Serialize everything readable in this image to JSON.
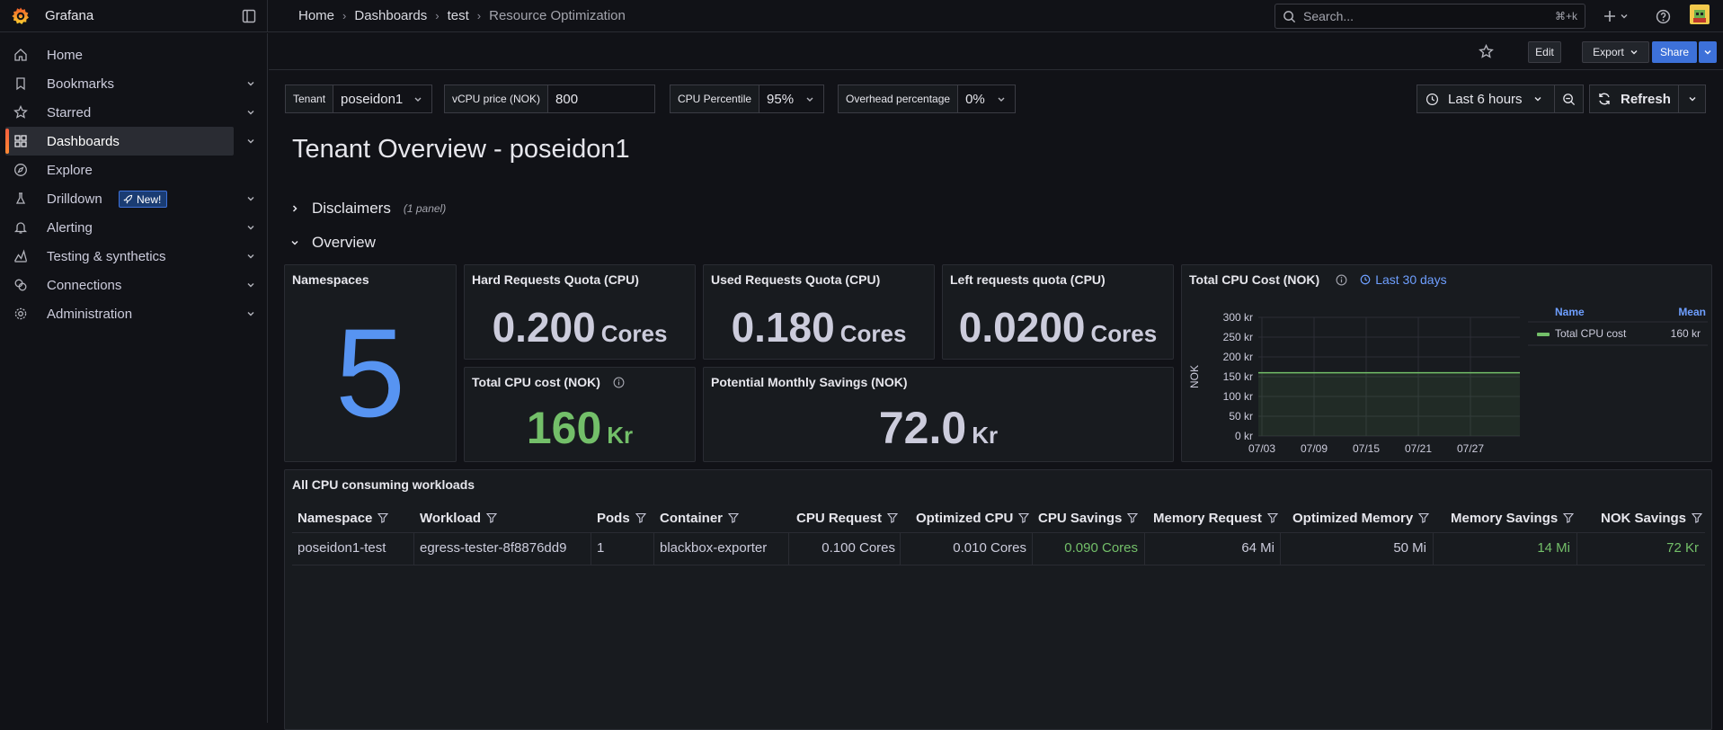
{
  "app": {
    "name": "Grafana"
  },
  "breadcrumbs": [
    "Home",
    "Dashboards",
    "test",
    "Resource Optimization"
  ],
  "search": {
    "placeholder": "Search...",
    "shortcut": "⌘+k"
  },
  "toolbar": {
    "edit": "Edit",
    "export": "Export",
    "share": "Share"
  },
  "sidebar": {
    "items": [
      {
        "label": "Home",
        "icon": "home-icon"
      },
      {
        "label": "Bookmarks",
        "icon": "bookmark-icon"
      },
      {
        "label": "Starred",
        "icon": "star-icon"
      },
      {
        "label": "Dashboards",
        "icon": "apps-icon",
        "active": true
      },
      {
        "label": "Explore",
        "icon": "compass-icon"
      },
      {
        "label": "Drilldown",
        "icon": "drilldown-icon",
        "badge": "New!"
      },
      {
        "label": "Alerting",
        "icon": "bell-icon"
      },
      {
        "label": "Testing & synthetics",
        "icon": "heart-rate-icon"
      },
      {
        "label": "Connections",
        "icon": "link-icon"
      },
      {
        "label": "Administration",
        "icon": "cog-icon"
      }
    ]
  },
  "variables": {
    "tenant": {
      "label": "Tenant",
      "value": "poseidon1"
    },
    "vcpu": {
      "label": "vCPU price (NOK)",
      "value": "800"
    },
    "percentile": {
      "label": "CPU Percentile",
      "value": "95%"
    },
    "overhead": {
      "label": "Overhead percentage",
      "value": "0%"
    }
  },
  "timepicker": {
    "range": "Last 6 hours",
    "refresh": "Refresh"
  },
  "dashboard": {
    "title": "Tenant Overview - poseidon1"
  },
  "rows": {
    "disclaimers": {
      "title": "Disclaimers",
      "note": "(1 panel)"
    },
    "overview": {
      "title": "Overview"
    }
  },
  "panels": {
    "namespaces": {
      "title": "Namespaces",
      "value": "5"
    },
    "hard_quota": {
      "title": "Hard Requests Quota (CPU)",
      "value": "0.200",
      "unit": "Cores"
    },
    "used_quota": {
      "title": "Used Requests Quota (CPU)",
      "value": "0.180",
      "unit": "Cores"
    },
    "left_quota": {
      "title": "Left requests quota (CPU)",
      "value": "0.0200",
      "unit": "Cores"
    },
    "total_cost": {
      "title": "Total CPU cost (NOK)",
      "value": "160",
      "unit": "Kr"
    },
    "savings": {
      "title": "Potential Monthly Savings (NOK)",
      "value": "72.0",
      "unit": "Kr"
    },
    "cost_chart": {
      "title": "Total CPU Cost (NOK)",
      "time_override": "Last 30 days"
    }
  },
  "chart_data": {
    "type": "line",
    "title": "Total CPU Cost (NOK)",
    "ylabel": "NOK",
    "xlabel": "",
    "x_ticks": [
      "07/03",
      "07/09",
      "07/15",
      "07/21",
      "07/27"
    ],
    "y_ticks": [
      "0 kr",
      "50 kr",
      "100 kr",
      "150 kr",
      "200 kr",
      "250 kr",
      "300 kr"
    ],
    "ylim": [
      0,
      300
    ],
    "grid": true,
    "legend": {
      "placement": "right",
      "header_name": "Name",
      "header_stat": "Mean"
    },
    "series": [
      {
        "name": "Total CPU cost",
        "color": "#73bf69",
        "values": [
          160,
          160,
          160,
          160,
          160
        ],
        "mean": "160 kr"
      }
    ]
  },
  "table": {
    "title": "All CPU consuming workloads",
    "columns": [
      "Namespace",
      "Workload",
      "Pods",
      "Container",
      "CPU Request",
      "Optimized CPU",
      "CPU Savings",
      "Memory Request",
      "Optimized Memory",
      "Memory Savings",
      "NOK Savings"
    ],
    "rows": [
      [
        "poseidon1-test",
        "egress-tester-8f8876dd9",
        "1",
        "blackbox-exporter",
        "0.100 Cores",
        "0.010 Cores",
        "0.090 Cores",
        "64 Mi",
        "50 Mi",
        "14 Mi",
        "72 Kr"
      ]
    ]
  },
  "colors": {
    "accent_green": "#73bf69",
    "stat_blue": "#5794f2",
    "link_blue": "#6e9fff",
    "primary_button": "#3d71d9"
  }
}
